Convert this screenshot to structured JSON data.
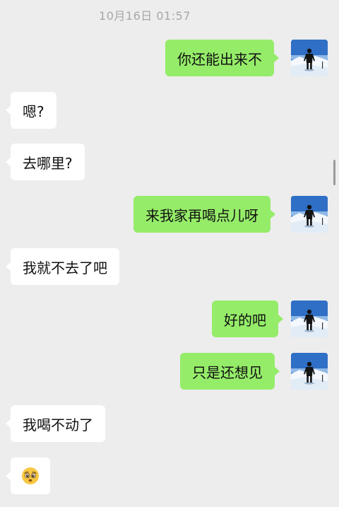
{
  "chat": {
    "timestamp": "10月16日 01:57",
    "messages": [
      {
        "side": "out",
        "text": "你还能出来不"
      },
      {
        "side": "in",
        "text": "嗯?"
      },
      {
        "side": "in",
        "text": "去哪里?"
      },
      {
        "side": "out",
        "text": "来我家再喝点儿呀"
      },
      {
        "side": "in",
        "text": "我就不去了吧"
      },
      {
        "side": "out",
        "text": "好的吧"
      },
      {
        "side": "out",
        "text": "只是还想见"
      },
      {
        "side": "in",
        "text": "我喝不动了"
      },
      {
        "side": "in",
        "emoji": "pleading-face-emoji"
      }
    ]
  },
  "colors": {
    "background": "#ededed",
    "outgoing_bubble": "#95ec69",
    "incoming_bubble": "#ffffff",
    "timestamp_text": "#a7a7a7"
  }
}
